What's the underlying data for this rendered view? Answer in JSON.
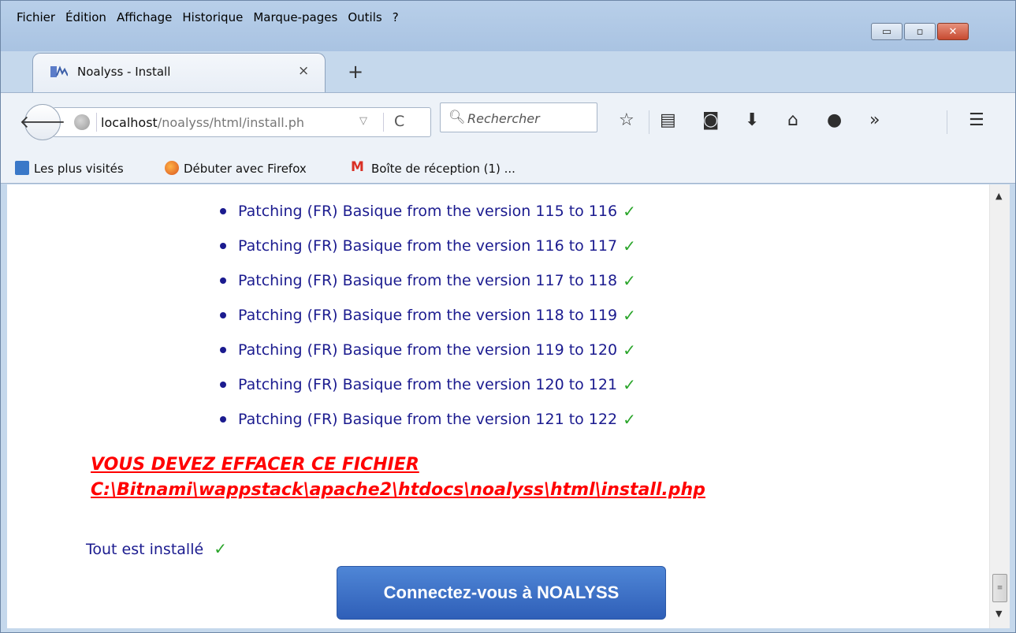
{
  "menu": {
    "items": [
      {
        "label": "Fichier"
      },
      {
        "label": "Édition"
      },
      {
        "label": "Affichage"
      },
      {
        "label": "Historique"
      },
      {
        "label": "Marque-pages"
      },
      {
        "label": "Outils"
      },
      {
        "label": "?"
      }
    ]
  },
  "window_controls": {
    "minimize": "▭",
    "maximize": "▫",
    "close": "✕"
  },
  "tab": {
    "title": "Noalyss - Install",
    "close": "×",
    "new_tab": "+"
  },
  "nav": {
    "url_host": "localhost",
    "url_path": "/noalyss/html/install.ph",
    "url_dropdown": "▽",
    "reload": "C",
    "search_placeholder": "Rechercher",
    "overflow": "»"
  },
  "bookmarks": [
    {
      "label": "Les plus visités"
    },
    {
      "label": "Débuter avec Firefox"
    },
    {
      "label": "Boîte de réception (1) ..."
    }
  ],
  "patches": [
    {
      "text": "Patching (FR) Basique from the version 115 to 116"
    },
    {
      "text": "Patching (FR) Basique from the version 116 to 117"
    },
    {
      "text": "Patching (FR) Basique from the version 117 to 118"
    },
    {
      "text": "Patching (FR) Basique from the version 118 to 119"
    },
    {
      "text": "Patching (FR) Basique from the version 119 to 120"
    },
    {
      "text": "Patching (FR) Basique from the version 120 to 121"
    },
    {
      "text": "Patching (FR) Basique from the version 121 to 122"
    }
  ],
  "check_mark": "✓",
  "warning": "VOUS DEVEZ EFFACER CE FICHIER C:\\Bitnami\\wappstack\\apache2\\htdocs\\noalyss\\html\\install.php",
  "installed": "Tout est installé",
  "connect_button": "Connectez-vous à NOALYSS",
  "colors": {
    "link_blue": "#1b1b8f",
    "check_green": "#2aa52a",
    "warning_red": "#ff0000",
    "button_blue": "#3a6ec6"
  }
}
